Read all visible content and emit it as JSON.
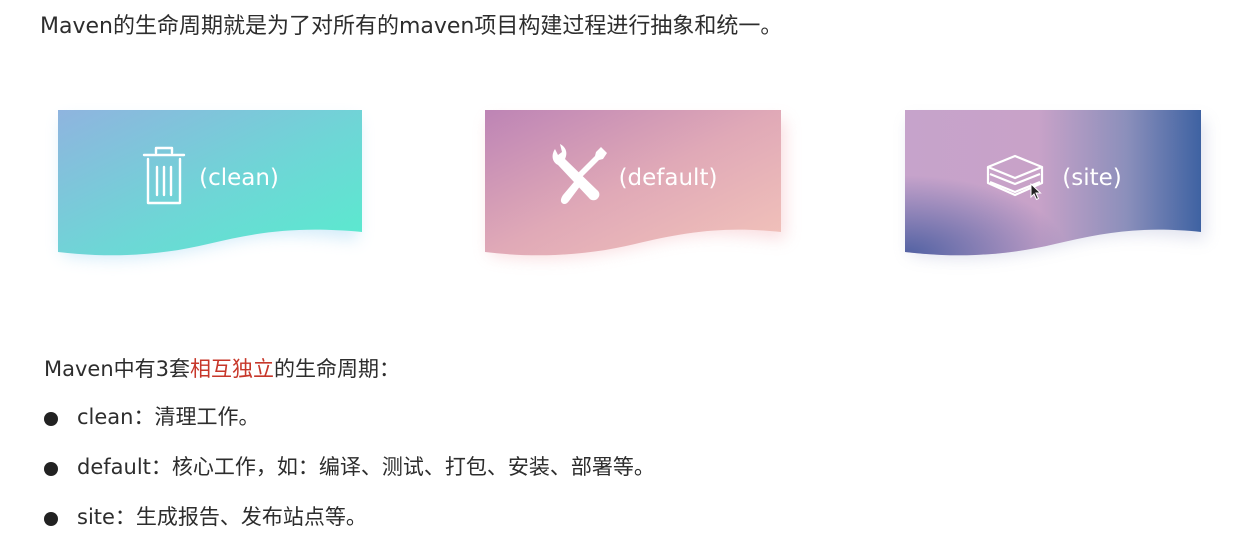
{
  "intro": {
    "text": "Maven的生命周期就是为了对所有的maven项目构建过程进行抽象和统一。"
  },
  "cards": [
    {
      "id": "clean",
      "label": "(clean)",
      "icon": "trash-icon",
      "gradient": [
        "#8fb6e0",
        "#5ce6cf"
      ]
    },
    {
      "id": "default",
      "label": "(default)",
      "icon": "tools-icon",
      "gradient": [
        "#c187b8",
        "#f0bcb7"
      ]
    },
    {
      "id": "site",
      "label": "(site)",
      "icon": "layers-icon",
      "gradient": [
        "#c3a3cb",
        "#3f63a3"
      ]
    }
  ],
  "summary": {
    "prefix": "Maven中有3套",
    "highlight": "相互独立",
    "suffix": "的生命周期：",
    "highlight_color": "#c7372a"
  },
  "bullets": [
    "clean：清理工作。",
    "default：核心工作，如：编译、测试、打包、安装、部署等。",
    "site：生成报告、发布站点等。"
  ]
}
